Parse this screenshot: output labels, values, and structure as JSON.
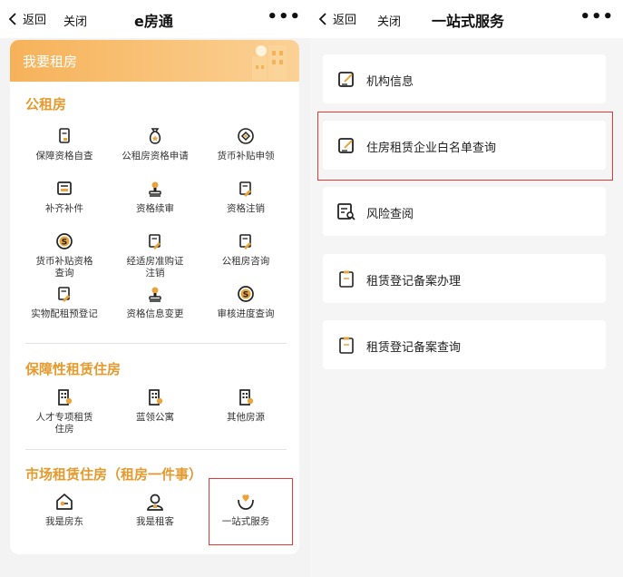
{
  "left": {
    "nav": {
      "back": "返回",
      "close": "关闭",
      "title": "e房通",
      "more": "•••"
    },
    "banner": {
      "title": "我要租房"
    },
    "sections": [
      {
        "title": "公租房",
        "items": [
          {
            "label": "保障资格自查",
            "icon": "document-check-icon"
          },
          {
            "label": "公租房资格申请",
            "icon": "money-bag-star-icon"
          },
          {
            "label": "货币补贴申领",
            "icon": "coin-circle-icon"
          },
          {
            "label": "补齐补件",
            "icon": "card-form-icon"
          },
          {
            "label": "资格续审",
            "icon": "stamp-icon"
          },
          {
            "label": "资格注销",
            "icon": "document-pen-icon"
          },
          {
            "label": "货币补贴资格\n查询",
            "icon": "dollar-coin-icon"
          },
          {
            "label": "经适房准购证\n注销",
            "icon": "document-pen-icon"
          },
          {
            "label": "公租房咨询",
            "icon": "document-pen-icon"
          },
          {
            "label": "实物配租预登记",
            "icon": "document-pen-icon"
          },
          {
            "label": "资格信息变更",
            "icon": "stamp-icon"
          },
          {
            "label": "审核进度查询",
            "icon": "dollar-coin-icon"
          }
        ]
      },
      {
        "title": "保障性租赁住房",
        "items": [
          {
            "label": "人才专项租赁\n住房",
            "icon": "building-user-icon"
          },
          {
            "label": "蓝领公寓",
            "icon": "building-user-icon"
          },
          {
            "label": "其他房源",
            "icon": "building-user-icon"
          }
        ]
      },
      {
        "title": "市场租赁住房（租房一件事）",
        "items": [
          {
            "label": "我是房东",
            "icon": "house-key-icon"
          },
          {
            "label": "我是租客",
            "icon": "person-icon"
          },
          {
            "label": "一站式服务",
            "icon": "hand-heart-icon"
          }
        ]
      }
    ]
  },
  "right": {
    "nav": {
      "back": "返回",
      "close": "关闭",
      "title": "一站式服务",
      "more": "•••"
    },
    "rows": [
      {
        "label": "机构信息",
        "icon": "edit-square-icon"
      },
      {
        "label": "住房租赁企业白名单查询",
        "icon": "edit-square-icon"
      },
      {
        "label": "风险查阅",
        "icon": "document-search-icon"
      },
      {
        "label": "租赁登记备案办理",
        "icon": "clipboard-icon"
      },
      {
        "label": "租赁登记备案查询",
        "icon": "clipboard-icon"
      }
    ]
  },
  "colors": {
    "accent": "#e39a2e",
    "banner": "#f6b259",
    "highlight": "#e53935"
  }
}
